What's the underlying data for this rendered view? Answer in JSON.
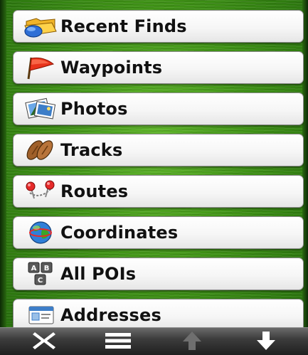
{
  "menu": {
    "items": [
      {
        "label": "Recent Finds",
        "icon": "recent-finds-folder-icon"
      },
      {
        "label": "Waypoints",
        "icon": "flag-icon"
      },
      {
        "label": "Photos",
        "icon": "photos-icon"
      },
      {
        "label": "Tracks",
        "icon": "footprints-icon"
      },
      {
        "label": "Routes",
        "icon": "route-pins-icon"
      },
      {
        "label": "Coordinates",
        "icon": "globe-icon"
      },
      {
        "label": "All POIs",
        "icon": "abc-keys-icon"
      },
      {
        "label": "Addresses",
        "icon": "address-card-icon"
      }
    ]
  },
  "toolbar": {
    "buttons": [
      {
        "icon": "close-icon",
        "enabled": true
      },
      {
        "icon": "menu-icon",
        "enabled": true
      },
      {
        "icon": "arrow-up-icon",
        "enabled": false
      },
      {
        "icon": "arrow-down-icon",
        "enabled": true
      }
    ]
  },
  "colors": {
    "background": "#3f9216",
    "button_face": "#f6f6f6",
    "toolbar": "#3c3c3c",
    "label_text": "#111111"
  }
}
